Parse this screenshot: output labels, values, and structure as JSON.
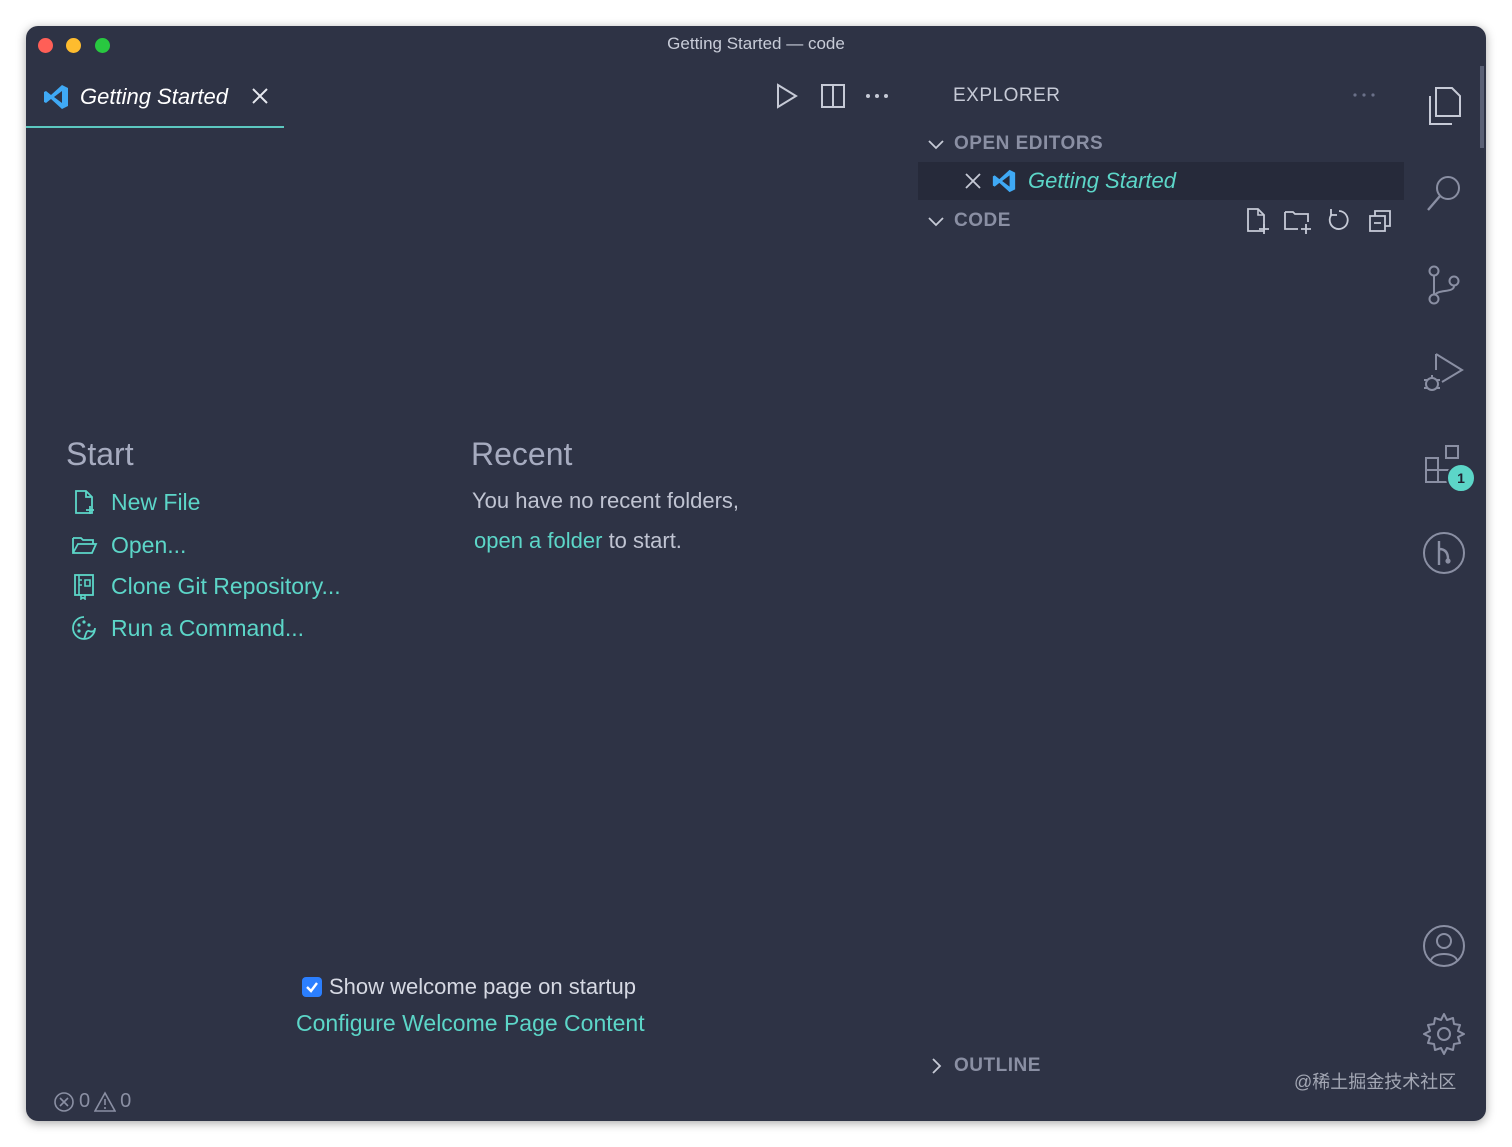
{
  "window": {
    "title": "Getting Started — code"
  },
  "tab": {
    "label": "Getting Started"
  },
  "welcome": {
    "start_title": "Start",
    "start_items": [
      {
        "label": "New File",
        "icon": "new-file-icon"
      },
      {
        "label": "Open...",
        "icon": "folder-open-icon"
      },
      {
        "label": "Clone Git Repository...",
        "icon": "git-clone-icon"
      },
      {
        "label": "Run a Command...",
        "icon": "command-palette-icon"
      }
    ],
    "recent_title": "Recent",
    "recent_line1": "You have no recent folders,",
    "recent_link": "open a folder",
    "recent_suffix": "to start.",
    "show_on_startup_label": "Show welcome page on startup",
    "show_on_startup_checked": true,
    "configure_link": "Configure Welcome Page Content"
  },
  "explorer": {
    "title": "EXPLORER",
    "open_editors_label": "OPEN EDITORS",
    "open_editor_item": "Getting Started",
    "folder_label": "CODE",
    "outline_label": "OUTLINE"
  },
  "activity_bar": {
    "items": [
      "explorer-icon",
      "search-icon",
      "source-control-icon",
      "run-debug-icon",
      "extensions-icon",
      "git-graph-icon"
    ],
    "extensions_badge": "1",
    "bottom": [
      "account-icon",
      "settings-gear-icon"
    ]
  },
  "status": {
    "errors": "0",
    "warnings": "0"
  },
  "watermark": "@稀土掘金技术社区",
  "colors": {
    "background": "#2e3345",
    "accent": "#5cd6c8",
    "text": "#c0c4d2"
  }
}
